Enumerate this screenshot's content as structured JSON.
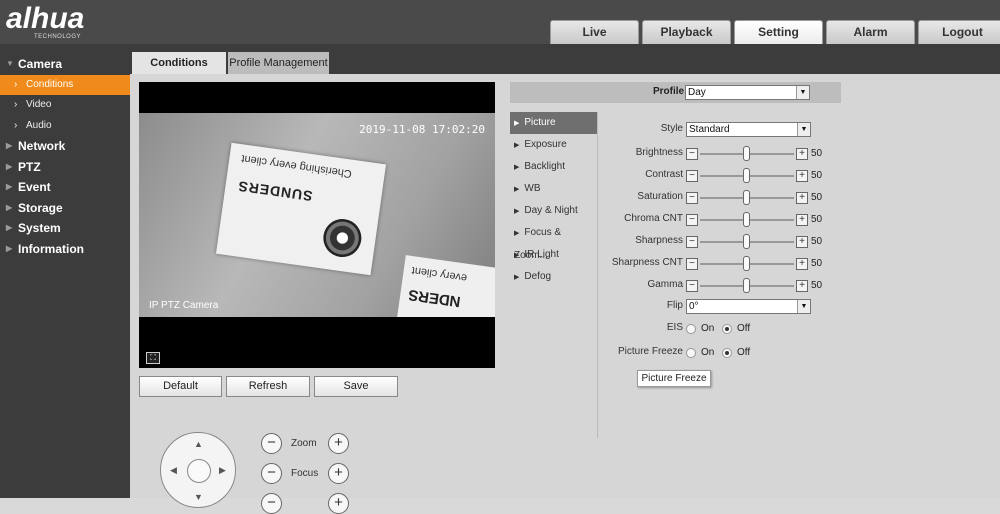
{
  "logo": {
    "brand": "alhua",
    "sub": "TECHNOLOGY"
  },
  "nav": {
    "tabs": [
      "Live",
      "Playback",
      "Setting",
      "Alarm",
      "Logout"
    ],
    "active": "Setting"
  },
  "sidebar": {
    "groups": [
      {
        "label": "Camera",
        "expanded": true,
        "items": [
          {
            "label": "Conditions",
            "active": true
          },
          {
            "label": "Video"
          },
          {
            "label": "Audio"
          }
        ]
      },
      {
        "label": "Network"
      },
      {
        "label": "PTZ"
      },
      {
        "label": "Event"
      },
      {
        "label": "Storage"
      },
      {
        "label": "System"
      },
      {
        "label": "Information"
      }
    ]
  },
  "subtabs": {
    "conditions": "Conditions",
    "profile": "Profile Management"
  },
  "video": {
    "timestamp": "2019-11-08 17:02:20",
    "camera_name": "IP PTZ Camera",
    "card_text_1": "Cherishing every client",
    "card_text_2": "SUNDERS",
    "card_text_3": "every client",
    "card_text_4": "NDERS"
  },
  "buttons": {
    "default": "Default",
    "refresh": "Refresh",
    "save": "Save"
  },
  "ptz": {
    "zoom": "Zoom",
    "focus": "Focus"
  },
  "profile": {
    "label": "Profile",
    "value": "Day"
  },
  "menu": [
    "Picture",
    "Exposure",
    "Backlight",
    "WB",
    "Day & Night",
    "Focus & Zoom...",
    "IR Light",
    "Defog"
  ],
  "picture": {
    "style_label": "Style",
    "style_value": "Standard",
    "sliders": [
      {
        "label": "Brightness",
        "value": "50"
      },
      {
        "label": "Contrast",
        "value": "50"
      },
      {
        "label": "Saturation",
        "value": "50"
      },
      {
        "label": "Chroma CNT",
        "value": "50"
      },
      {
        "label": "Sharpness",
        "value": "50"
      },
      {
        "label": "Sharpness CNT",
        "value": "50"
      },
      {
        "label": "Gamma",
        "value": "50"
      }
    ],
    "flip_label": "Flip",
    "flip_value": "0°",
    "eis_label": "EIS",
    "eis_on": "On",
    "eis_off": "Off",
    "freeze_label": "Picture Freeze",
    "freeze_on": "On",
    "freeze_off": "Off",
    "tooltip": "Picture Freeze"
  },
  "colors": {
    "accent": "#f08a1a",
    "sidebar": "#3c3c3c",
    "topbar": "#4a4a4a"
  }
}
